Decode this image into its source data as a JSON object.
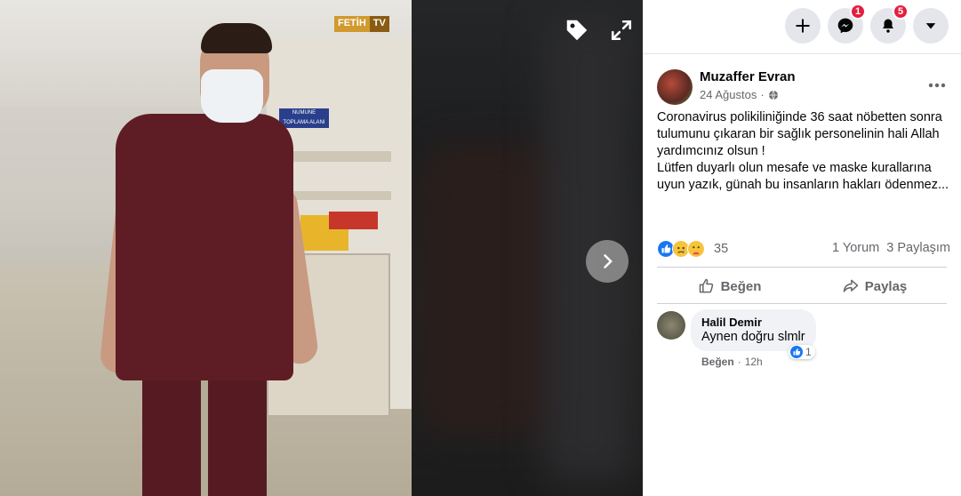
{
  "viewer": {
    "watermark": {
      "part1": "FETİH",
      "part2": "TV"
    },
    "poster_sign": "NUMUNE TOPLAMA ALANI"
  },
  "topbar": {
    "messenger_badge": "1",
    "notifications_badge": "5"
  },
  "post": {
    "author": "Muzaffer Evran",
    "date": "24 Ağustos",
    "privacy_symbol": "·",
    "text_lines": [
      "Coronavirus polikiliniğinde 36 saat nöbetten sonra tulumunu çıkaran bir sağlık personelinin hali Allah yardımcınız olsun !",
      "Lütfen duyarlı olun mesafe ve maske kurallarına uyun yazık, günah bu insanların hakları ödenmez..."
    ],
    "reaction_count": "35",
    "comments_count": "1 Yorum",
    "shares_count": "3 Paylaşım",
    "like_label": "Beğen",
    "share_label": "Paylaş"
  },
  "comment": {
    "author": "Halil Demir",
    "text": "Aynen doğru slmlr",
    "like_label": "Beğen",
    "separator": "·",
    "time": "12h",
    "like_count": "1"
  },
  "colors": {
    "accent": "#1877f2",
    "badge": "#e41e3f",
    "scrubs": "#5e1d24"
  }
}
